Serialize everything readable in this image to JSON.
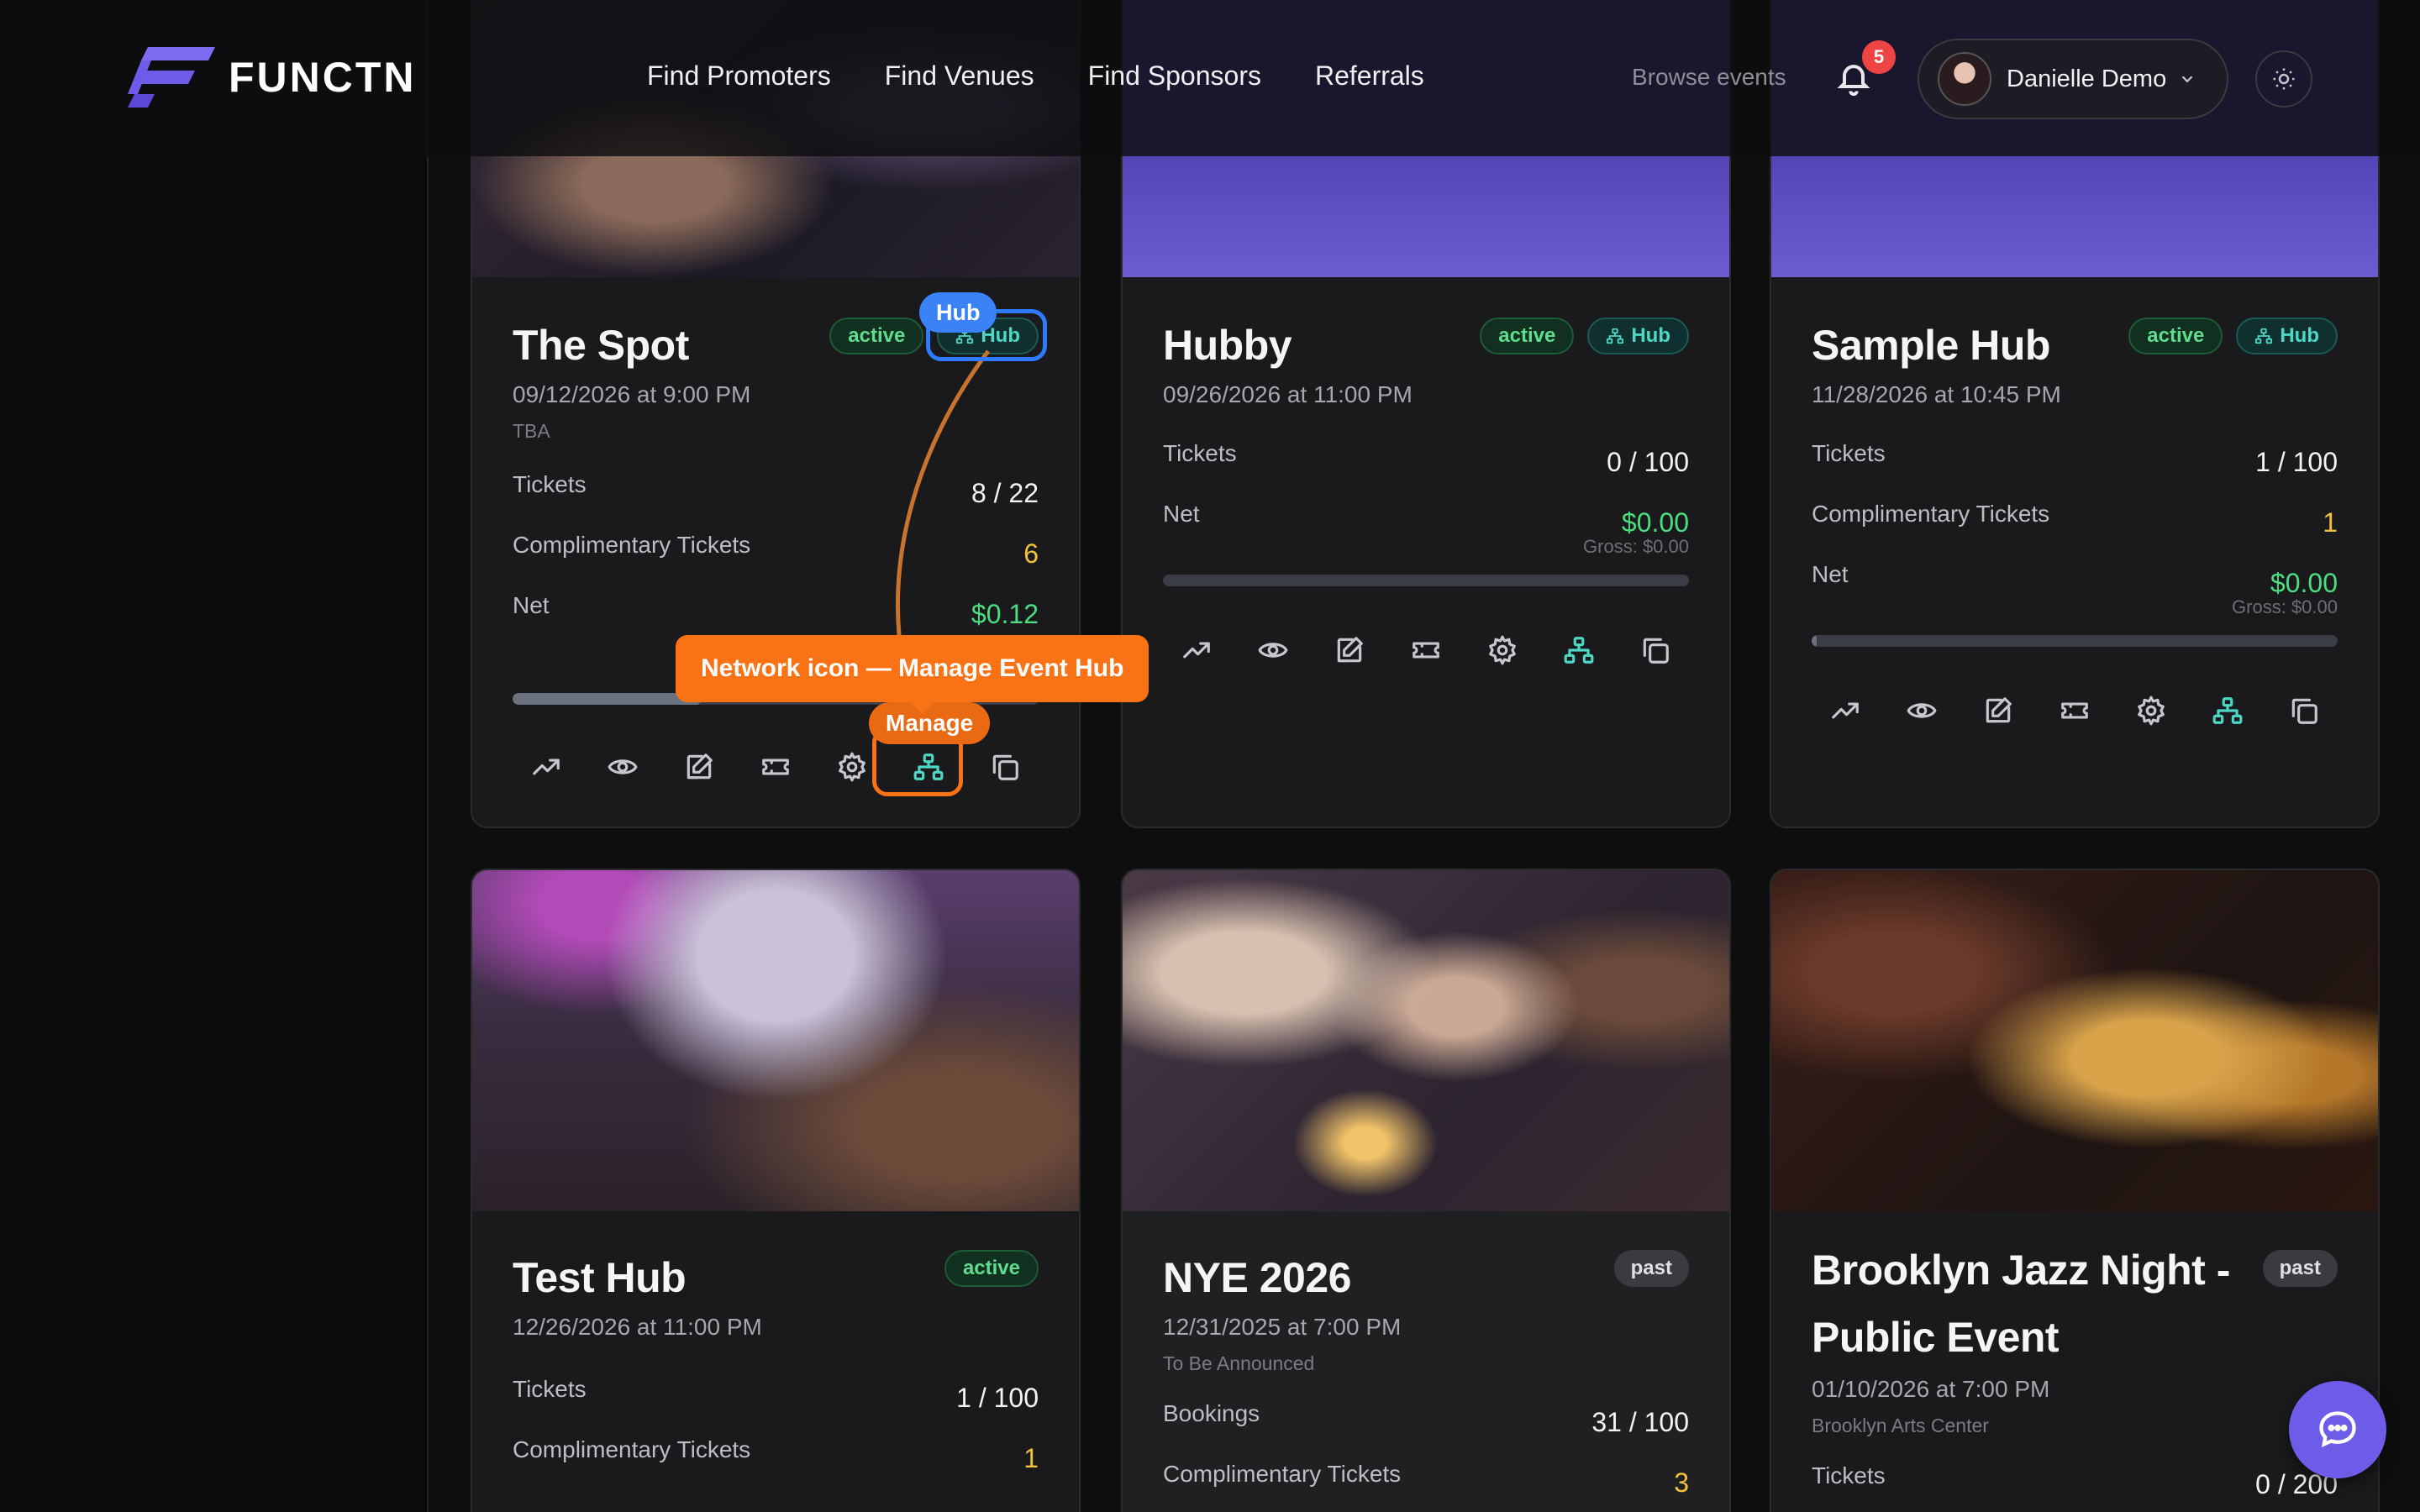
{
  "brand": {
    "name": "FUNCTN",
    "accent": "#6d5ce8"
  },
  "nav": {
    "links": [
      "Find Promoters",
      "Find Venues",
      "Find Sponsors",
      "Referrals"
    ],
    "browse": "Browse events",
    "notifications": "5",
    "user": "Danielle Demo"
  },
  "cards": [
    {
      "title": "The Spot",
      "date": "09/12/2026 at 9:00 PM",
      "venue": "TBA",
      "status": "active",
      "hub": "Hub",
      "stats": [
        {
          "label": "Tickets",
          "value": "8 / 22"
        },
        {
          "label": "Complimentary Tickets",
          "value": "6"
        },
        {
          "label": "Net",
          "value": "$0.12"
        }
      ],
      "progress": 0.36
    },
    {
      "title": "Hubby",
      "date": "09/26/2026 at 11:00 PM",
      "status": "active",
      "hub": "Hub",
      "stats": [
        {
          "label": "Tickets",
          "value": "0 / 100"
        },
        {
          "label": "Net",
          "value": "$0.00"
        }
      ],
      "gross": "Gross: $0.00",
      "progress": 0.0
    },
    {
      "title": "Sample Hub",
      "date": "11/28/2026 at 10:45 PM",
      "status": "active",
      "hub": "Hub",
      "stats": [
        {
          "label": "Tickets",
          "value": "1 / 100"
        },
        {
          "label": "Complimentary Tickets",
          "value": "1"
        },
        {
          "label": "Net",
          "value": "$0.00"
        }
      ],
      "gross": "Gross: $0.00",
      "progress": 0.01
    },
    {
      "title": "Test Hub",
      "date": "12/26/2026 at 11:00 PM",
      "status": "active",
      "stats": [
        {
          "label": "Tickets",
          "value": "1 / 100"
        },
        {
          "label": "Complimentary Tickets",
          "value": "1"
        }
      ]
    },
    {
      "title": "NYE 2026",
      "date": "12/31/2025 at 7:00 PM",
      "venue": "To Be Announced",
      "status": "past",
      "stats": [
        {
          "label": "Bookings",
          "value": "31 / 100"
        },
        {
          "label": "Complimentary Tickets",
          "value": "3"
        }
      ]
    },
    {
      "title_line1": "Brooklyn Jazz Night -",
      "title_line2": "Public Event",
      "date": "01/10/2026 at 7:00 PM",
      "venue": "Brooklyn Arts Center",
      "status": "past",
      "stats": [
        {
          "label": "Tickets",
          "value": "0 / 200"
        }
      ]
    }
  ],
  "annotations": {
    "hub_tag": "Hub",
    "manage_tag": "Manage",
    "callout": "Network icon — Manage Event Hub"
  },
  "icons": [
    "trending-icon",
    "eye-icon",
    "edit-icon",
    "ticket-icon",
    "gear-icon",
    "network-icon",
    "copy-icon",
    "bell-icon",
    "sun-icon",
    "chat-icon"
  ]
}
